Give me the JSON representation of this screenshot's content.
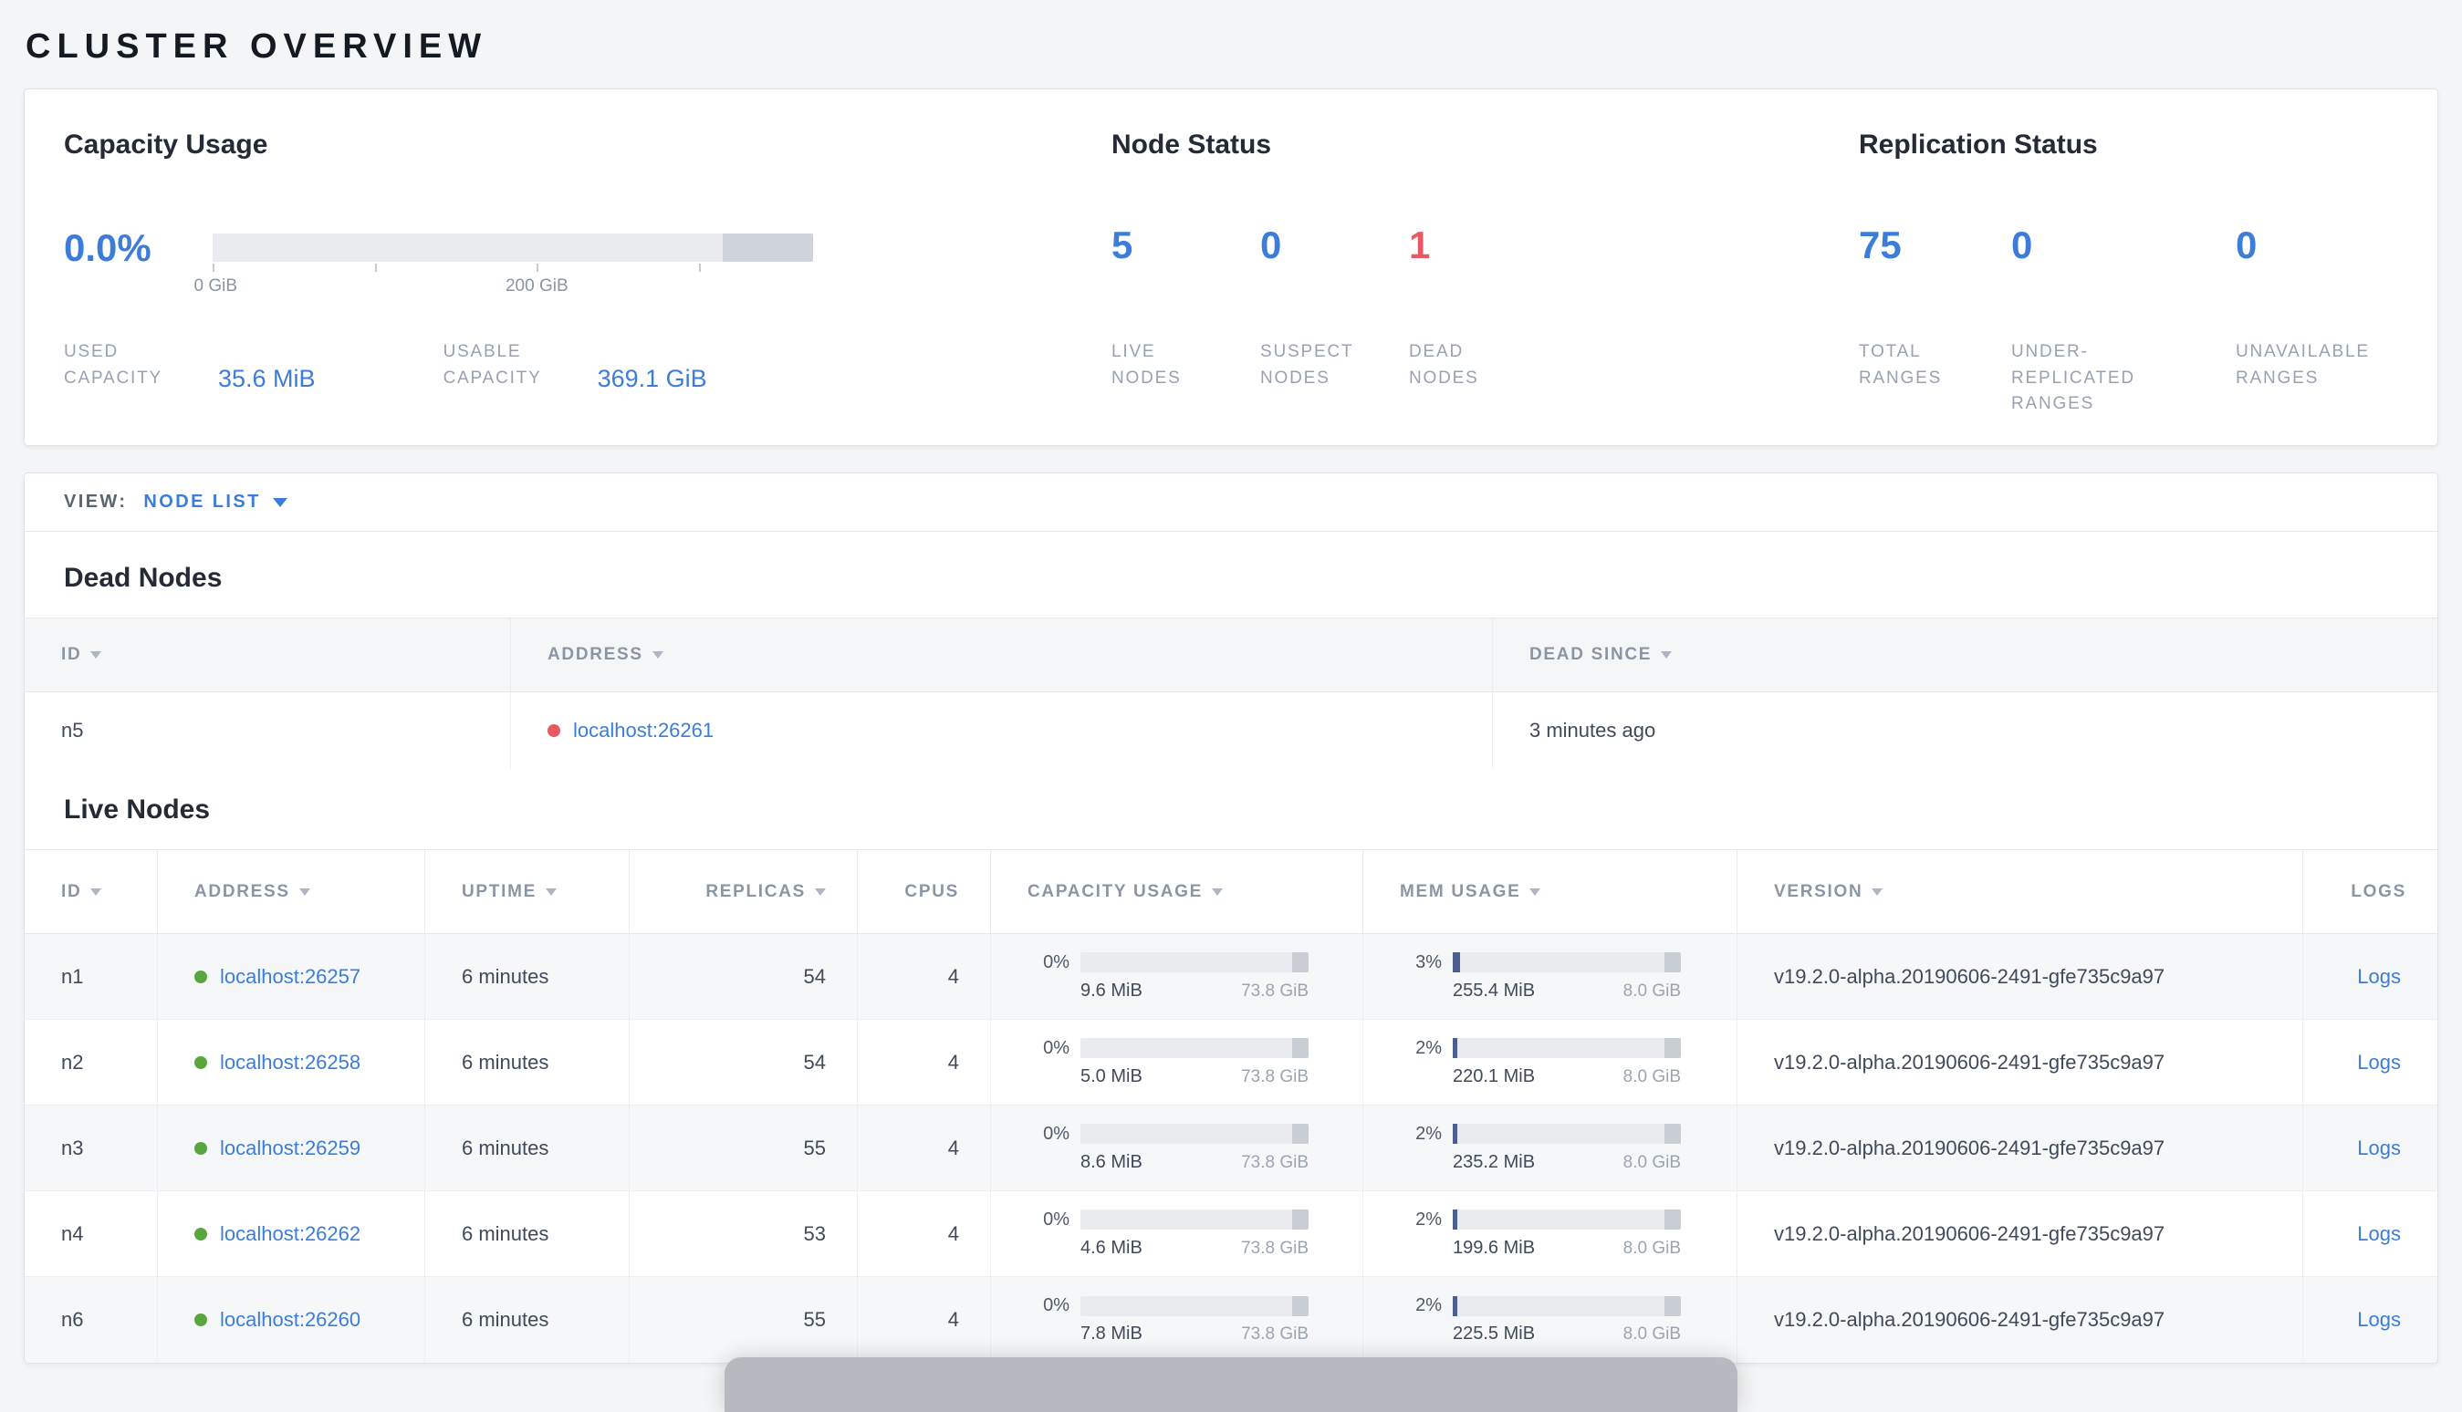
{
  "page": {
    "title": "CLUSTER OVERVIEW"
  },
  "summary": {
    "capacity": {
      "heading": "Capacity Usage",
      "percent": "0.0%",
      "fill_style": "width:0%",
      "tick_labels": [
        "0 GiB",
        "200 GiB"
      ],
      "used_label": "USED CAPACITY",
      "used_value": "35.6 MiB",
      "usable_label": "USABLE CAPACITY",
      "usable_value": "369.1 GiB"
    },
    "node_status": {
      "heading": "Node Status",
      "stats": [
        {
          "value": "5",
          "label": "LIVE NODES"
        },
        {
          "value": "0",
          "label": "SUSPECT NODES"
        },
        {
          "value": "1",
          "label": "DEAD NODES"
        }
      ]
    },
    "replication": {
      "heading": "Replication Status",
      "stats": [
        {
          "value": "75",
          "label": "TOTAL RANGES"
        },
        {
          "value": "0",
          "label": "UNDER-REPLICATED RANGES"
        },
        {
          "value": "0",
          "label": "UNAVAILABLE RANGES"
        }
      ]
    }
  },
  "view_bar": {
    "label": "VIEW:",
    "selected": "NODE LIST"
  },
  "dead_nodes": {
    "heading": "Dead Nodes",
    "columns": [
      "ID",
      "ADDRESS",
      "DEAD SINCE"
    ],
    "rows": [
      {
        "id": "n5",
        "address": "localhost:26261",
        "dead_since": "3 minutes ago"
      }
    ]
  },
  "live_nodes": {
    "heading": "Live Nodes",
    "columns": [
      "ID",
      "ADDRESS",
      "UPTIME",
      "REPLICAS",
      "CPUS",
      "CAPACITY USAGE",
      "MEM USAGE",
      "VERSION",
      "LOGS"
    ],
    "rows": [
      {
        "id": "n1",
        "address": "localhost:26257",
        "uptime": "6 minutes",
        "replicas": "54",
        "cpus": "4",
        "capacity": {
          "percent": "0%",
          "fill_style": "width:0%",
          "used": "9.6 MiB",
          "total": "73.8 GiB"
        },
        "mem": {
          "percent": "3%",
          "fill_style": "width:3%",
          "used": "255.4 MiB",
          "total": "8.0 GiB"
        },
        "version": "v19.2.0-alpha.20190606-2491-gfe735c9a97",
        "logs_label": "Logs"
      },
      {
        "id": "n2",
        "address": "localhost:26258",
        "uptime": "6 minutes",
        "replicas": "54",
        "cpus": "4",
        "capacity": {
          "percent": "0%",
          "fill_style": "width:0%",
          "used": "5.0 MiB",
          "total": "73.8 GiB"
        },
        "mem": {
          "percent": "2%",
          "fill_style": "width:2%",
          "used": "220.1 MiB",
          "total": "8.0 GiB"
        },
        "version": "v19.2.0-alpha.20190606-2491-gfe735c9a97",
        "logs_label": "Logs"
      },
      {
        "id": "n3",
        "address": "localhost:26259",
        "uptime": "6 minutes",
        "replicas": "55",
        "cpus": "4",
        "capacity": {
          "percent": "0%",
          "fill_style": "width:0%",
          "used": "8.6 MiB",
          "total": "73.8 GiB"
        },
        "mem": {
          "percent": "2%",
          "fill_style": "width:2%",
          "used": "235.2 MiB",
          "total": "8.0 GiB"
        },
        "version": "v19.2.0-alpha.20190606-2491-gfe735c9a97",
        "logs_label": "Logs"
      },
      {
        "id": "n4",
        "address": "localhost:26262",
        "uptime": "6 minutes",
        "replicas": "53",
        "cpus": "4",
        "capacity": {
          "percent": "0%",
          "fill_style": "width:0%",
          "used": "4.6 MiB",
          "total": "73.8 GiB"
        },
        "mem": {
          "percent": "2%",
          "fill_style": "width:2%",
          "used": "199.6 MiB",
          "total": "8.0 GiB"
        },
        "version": "v19.2.0-alpha.20190606-2491-gfe735c9a97",
        "logs_label": "Logs"
      },
      {
        "id": "n6",
        "address": "localhost:26260",
        "uptime": "6 minutes",
        "replicas": "55",
        "cpus": "4",
        "capacity": {
          "percent": "0%",
          "fill_style": "width:0%",
          "used": "7.8 MiB",
          "total": "73.8 GiB"
        },
        "mem": {
          "percent": "2%",
          "fill_style": "width:2%",
          "used": "225.5 MiB",
          "total": "8.0 GiB"
        },
        "version": "v19.2.0-alpha.20190606-2491-gfe735c9a97",
        "logs_label": "Logs"
      }
    ]
  },
  "colors": {
    "accent_blue": "#3b7dd8",
    "danger_red": "#e65a63",
    "live_green": "#5aa63e"
  }
}
